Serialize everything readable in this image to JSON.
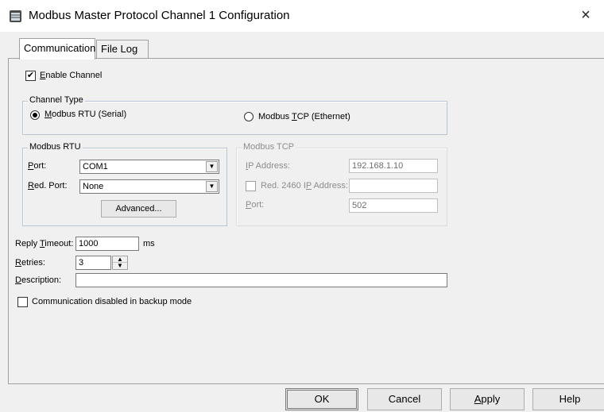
{
  "window": {
    "title": "Modbus Master Protocol Channel 1 Configuration",
    "close_glyph": "×"
  },
  "tabs": [
    {
      "label": "Communication",
      "active": true
    },
    {
      "label": "File Log",
      "active": false
    }
  ],
  "enable_channel": {
    "label_underline": "E",
    "label_rest": "nable Channel",
    "checked": true,
    "check_glyph": "✔"
  },
  "channel_type": {
    "legend": "Channel Type",
    "rtu": {
      "label_underline": "M",
      "label_rest": "odbus RTU (Serial)",
      "selected": true
    },
    "tcp": {
      "label_pre": "Modbus ",
      "label_underline": "T",
      "label_rest": "CP (Ethernet)",
      "selected": false
    }
  },
  "modbus_rtu": {
    "legend": "Modbus RTU",
    "port_label_underline": "P",
    "port_label_rest": "ort:",
    "port_value": "COM1",
    "red_port_label_underline": "R",
    "red_port_label_rest": "ed. Port:",
    "red_port_value": "None",
    "advanced_label": "Advanced...",
    "dropdown_glyph": "▼"
  },
  "modbus_tcp": {
    "legend": "Modbus TCP",
    "ip_label_underline": "I",
    "ip_label_rest": "P Address:",
    "ip_value": "192.168.1.10",
    "red_ip_label_pre": "Red. 2460 I",
    "red_ip_label_underline": "P",
    "red_ip_label_rest": " Address:",
    "red_ip_value": "",
    "port_label_underline": "P",
    "port_label_rest": "ort:",
    "port_value": "502"
  },
  "reply_timeout": {
    "label_pre": "Reply ",
    "label_underline": "T",
    "label_rest": "imeout:",
    "value": "1000",
    "unit": "ms"
  },
  "retries": {
    "label_underline": "R",
    "label_rest": "etries:",
    "value": "3",
    "up_glyph": "▲",
    "down_glyph": "▼"
  },
  "description": {
    "label_underline": "D",
    "label_rest": "escription:",
    "value": ""
  },
  "backup_mode": {
    "label": "Communication disabled in backup mode",
    "checked": false
  },
  "buttons": {
    "ok": "OK",
    "cancel": "Cancel",
    "apply_underline": "A",
    "apply_rest": "pply",
    "help": "Help"
  },
  "colors": {
    "window_bg": "#f0f0f0",
    "title_bg": "#ffffff",
    "groupbox_border": "#b7c6d6"
  }
}
